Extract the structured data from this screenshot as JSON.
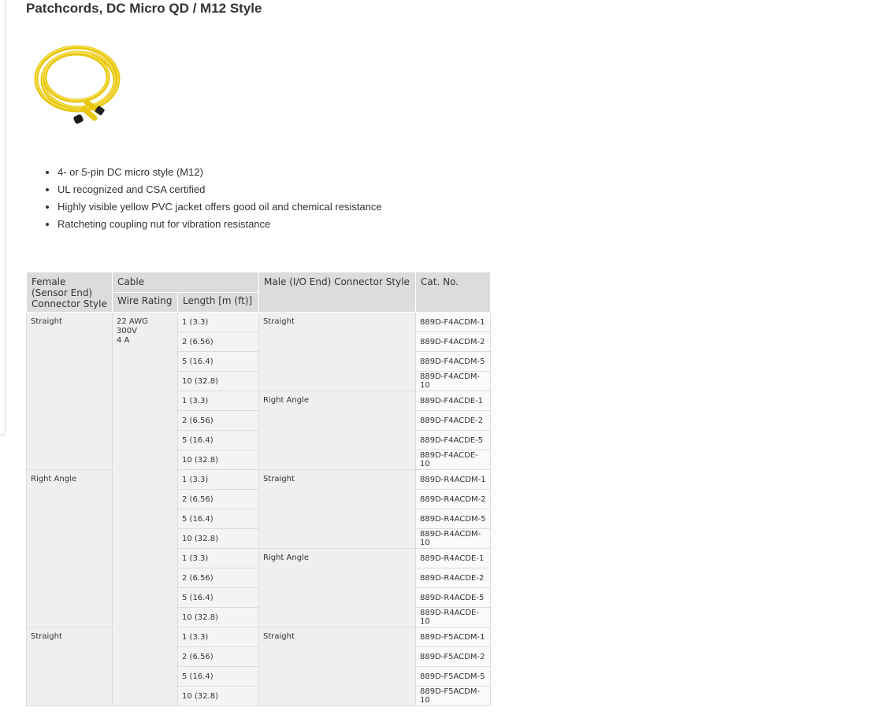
{
  "page": {
    "title": "Patchcords, DC Micro QD / M12 Style"
  },
  "features": [
    "4- or 5-pin DC micro style (M12)",
    "UL recognized and CSA certified",
    "Highly visible yellow PVC jacket offers good oil and chemical resistance",
    "Ratcheting coupling nut for vibration resistance"
  ],
  "table": {
    "headers": {
      "female_line1": "Female",
      "female_line2": "(Sensor End)",
      "female_line3": "Connector Style",
      "cable": "Cable",
      "male": "Male (I/O End) Connector Style",
      "catno": "Cat. No.",
      "wire_rating": "Wire Rating",
      "length": "Length [m (ft)]"
    },
    "wire_rating": [
      "22 AWG",
      "300V",
      "4 A"
    ],
    "female_groups": [
      "Straight",
      "Right Angle",
      "Straight"
    ],
    "male_groups": [
      "Straight",
      "Right Angle",
      "Straight",
      "Right Angle",
      "Straight"
    ],
    "lengths": [
      "1 (3.3)",
      "2 (6.56)",
      "5 (16.4)",
      "10 (32.8)",
      "1 (3.3)",
      "2 (6.56)",
      "5 (16.4)",
      "10 (32.8)",
      "1 (3.3)",
      "2 (6.56)",
      "5 (16.4)",
      "10 (32.8)",
      "1 (3.3)",
      "2 (6.56)",
      "5 (16.4)",
      "10 (32.8)",
      "1 (3.3)",
      "2 (6.56)",
      "5 (16.4)",
      "10 (32.8)"
    ],
    "cat_nos": [
      "889D-F4ACDM-1",
      "889D-F4ACDM-2",
      "889D-F4ACDM-5",
      "889D-F4ACDM-10",
      "889D-F4ACDE-1",
      "889D-F4ACDE-2",
      "889D-F4ACDE-5",
      "889D-F4ACDE-10",
      "889D-R4ACDM-1",
      "889D-R4ACDM-2",
      "889D-R4ACDM-5",
      "889D-R4ACDM-10",
      "889D-R4ACDE-1",
      "889D-R4ACDE-2",
      "889D-R4ACDE-5",
      "889D-R4ACDE-10",
      "889D-F5ACDM-1",
      "889D-F5ACDM-2",
      "889D-F5ACDM-5",
      "889D-F5ACDM-10"
    ]
  },
  "colors": {
    "header_bg": "#dcdcdc",
    "group_bg": "#efefef",
    "cable_yellow": "#f2d21c"
  },
  "icons": {
    "product_image": "yellow-coiled-patchcord"
  }
}
